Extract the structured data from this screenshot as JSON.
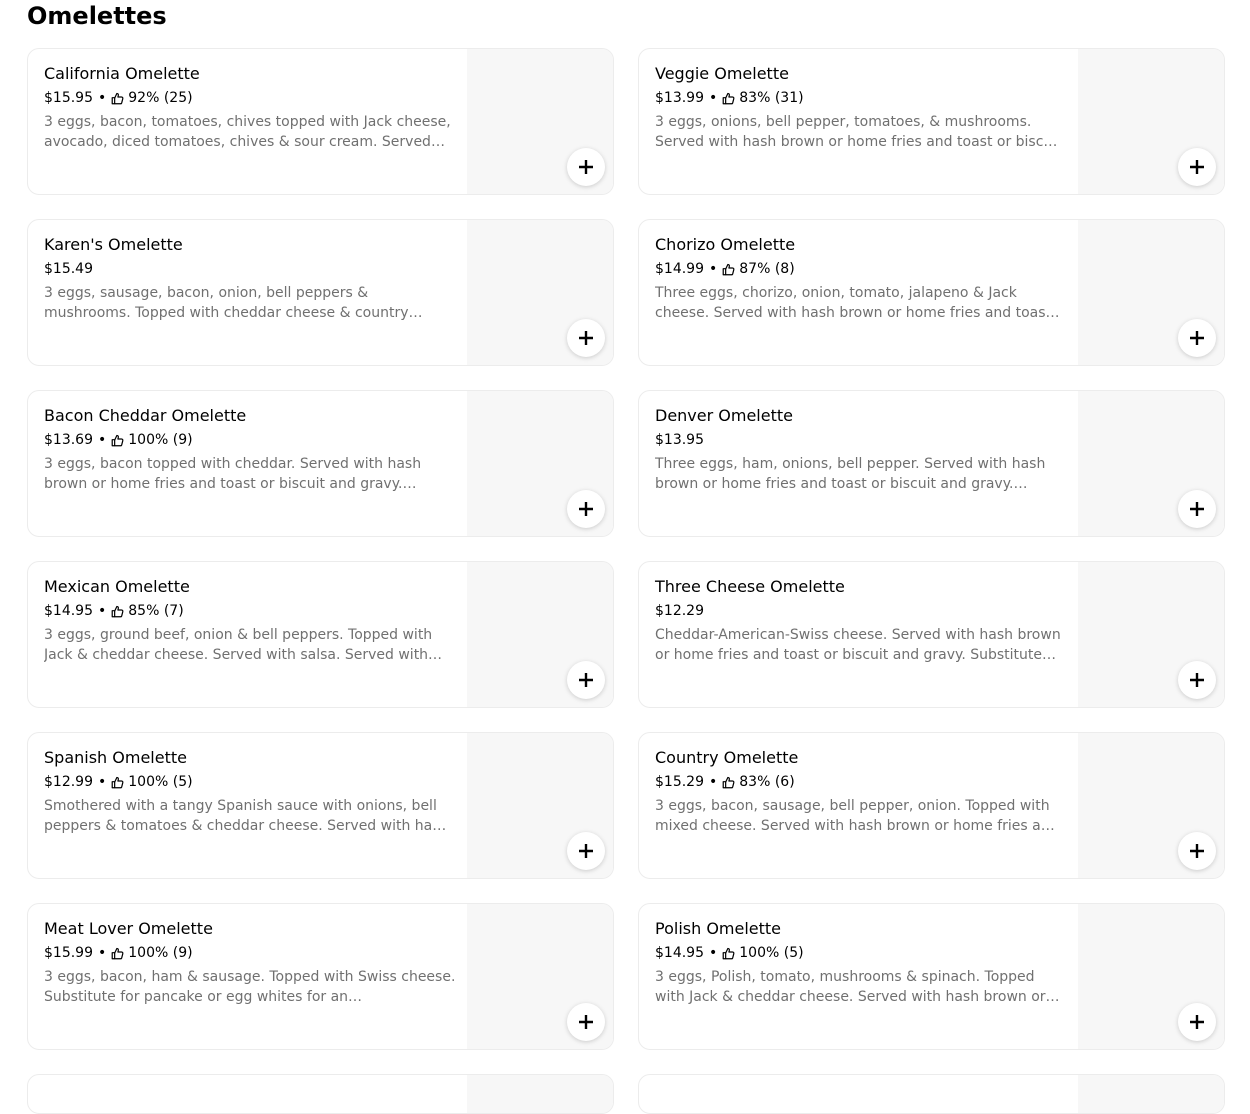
{
  "section": {
    "title": "Omelettes"
  },
  "items": [
    {
      "name": "California Omelette",
      "price": "$15.95",
      "rating": "92% (25)",
      "description": "3 eggs, bacon, tomatoes, chives topped with Jack cheese, avocado, diced tomatoes, chives & sour cream. Served…"
    },
    {
      "name": "Veggie Omelette",
      "price": "$13.99",
      "rating": "83% (31)",
      "description": "3 eggs, onions, bell pepper, tomatoes, & mushrooms. Served with hash brown or home fries and toast or bisc…"
    },
    {
      "name": "Karen's Omelette",
      "price": "$15.49",
      "rating": null,
      "description": "3 eggs, sausage, bacon, onion, bell peppers & mushrooms. Topped with cheddar cheese & country…"
    },
    {
      "name": "Chorizo Omelette",
      "price": "$14.99",
      "rating": "87% (8)",
      "description": "Three eggs, chorizo, onion, tomato, jalapeno & Jack cheese. Served with hash brown or home fries and toas…"
    },
    {
      "name": "Bacon Cheddar Omelette",
      "price": "$13.69",
      "rating": "100% (9)",
      "description": "3 eggs, bacon topped with cheddar. Served with hash brown or home fries and toast or biscuit and gravy.…"
    },
    {
      "name": "Denver Omelette",
      "price": "$13.95",
      "rating": null,
      "description": "Three eggs, ham, onions, bell pepper. Served with hash brown or home fries and toast or biscuit and gravy.…"
    },
    {
      "name": "Mexican Omelette",
      "price": "$14.95",
      "rating": "85% (7)",
      "description": "3 eggs, ground beef, onion & bell peppers. Topped with Jack & cheddar cheese. Served with salsa. Served with…"
    },
    {
      "name": "Three Cheese Omelette",
      "price": "$12.29",
      "rating": null,
      "description": "Cheddar-American-Swiss cheese. Served with hash brown or home fries and toast or biscuit and gravy. Substitute…"
    },
    {
      "name": "Spanish Omelette",
      "price": "$12.99",
      "rating": "100% (5)",
      "description": "Smothered with a tangy Spanish sauce with onions, bell peppers & tomatoes & cheddar cheese. Served with ha…"
    },
    {
      "name": "Country Omelette",
      "price": "$15.29",
      "rating": "83% (6)",
      "description": "3 eggs, bacon, sausage, bell pepper, onion. Topped with mixed cheese. Served with hash brown or home fries a…"
    },
    {
      "name": "Meat Lover Omelette",
      "price": "$15.99",
      "rating": "100% (9)",
      "description": "3 eggs, bacon, ham & sausage. Topped with Swiss cheese. Substitute for pancake or egg whites for an…"
    },
    {
      "name": "Polish Omelette",
      "price": "$14.95",
      "rating": "100% (5)",
      "description": "3 eggs, Polish, tomato, mushrooms & spinach. Topped with Jack & cheddar cheese. Served with hash brown or…"
    }
  ],
  "icons": {
    "rating": "thumbs-up-icon",
    "add": "plus-icon"
  },
  "colors": {
    "text": "#000000",
    "description": "#707070",
    "card_border": "#ececec",
    "image_placeholder": "#f7f7f7"
  }
}
